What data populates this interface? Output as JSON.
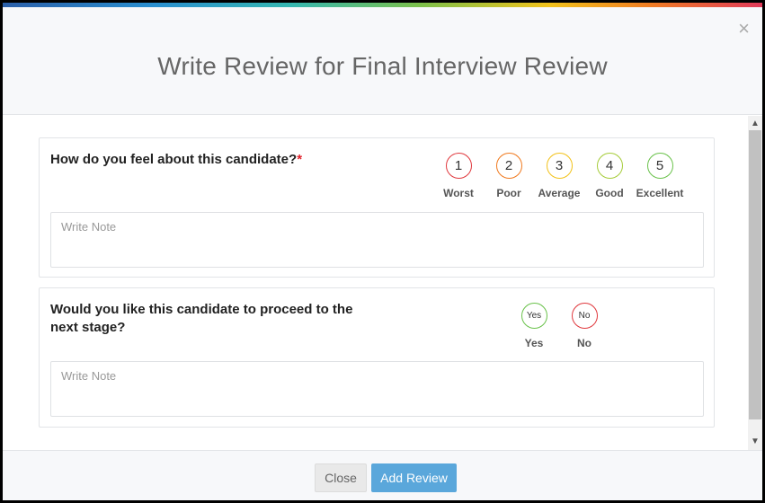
{
  "modal": {
    "title": "Write Review for Final Interview Review",
    "close_symbol": "×"
  },
  "question1": {
    "text": "How do you feel about this candidate?",
    "required_mark": "*",
    "options": [
      {
        "value": "1",
        "label": "Worst",
        "color": "#e0393e"
      },
      {
        "value": "2",
        "label": "Poor",
        "color": "#f07a1f"
      },
      {
        "value": "3",
        "label": "Average",
        "color": "#f2c21b"
      },
      {
        "value": "4",
        "label": "Good",
        "color": "#a6cc3a"
      },
      {
        "value": "5",
        "label": "Excellent",
        "color": "#6ac24b"
      }
    ],
    "note_placeholder": "Write Note"
  },
  "question2": {
    "text": "Would you like this candidate to proceed to the next stage?",
    "options": [
      {
        "value": "Yes",
        "label": "Yes",
        "color": "#6ac24b"
      },
      {
        "value": "No",
        "label": "No",
        "color": "#e0393e"
      }
    ],
    "note_placeholder": "Write Note"
  },
  "scrollbar": {
    "up_icon": "chevron-up-icon",
    "down_icon": "chevron-down-icon"
  },
  "footer": {
    "close_label": "Close",
    "add_label": "Add Review"
  },
  "colors": {
    "accent": "#5aa7db"
  }
}
